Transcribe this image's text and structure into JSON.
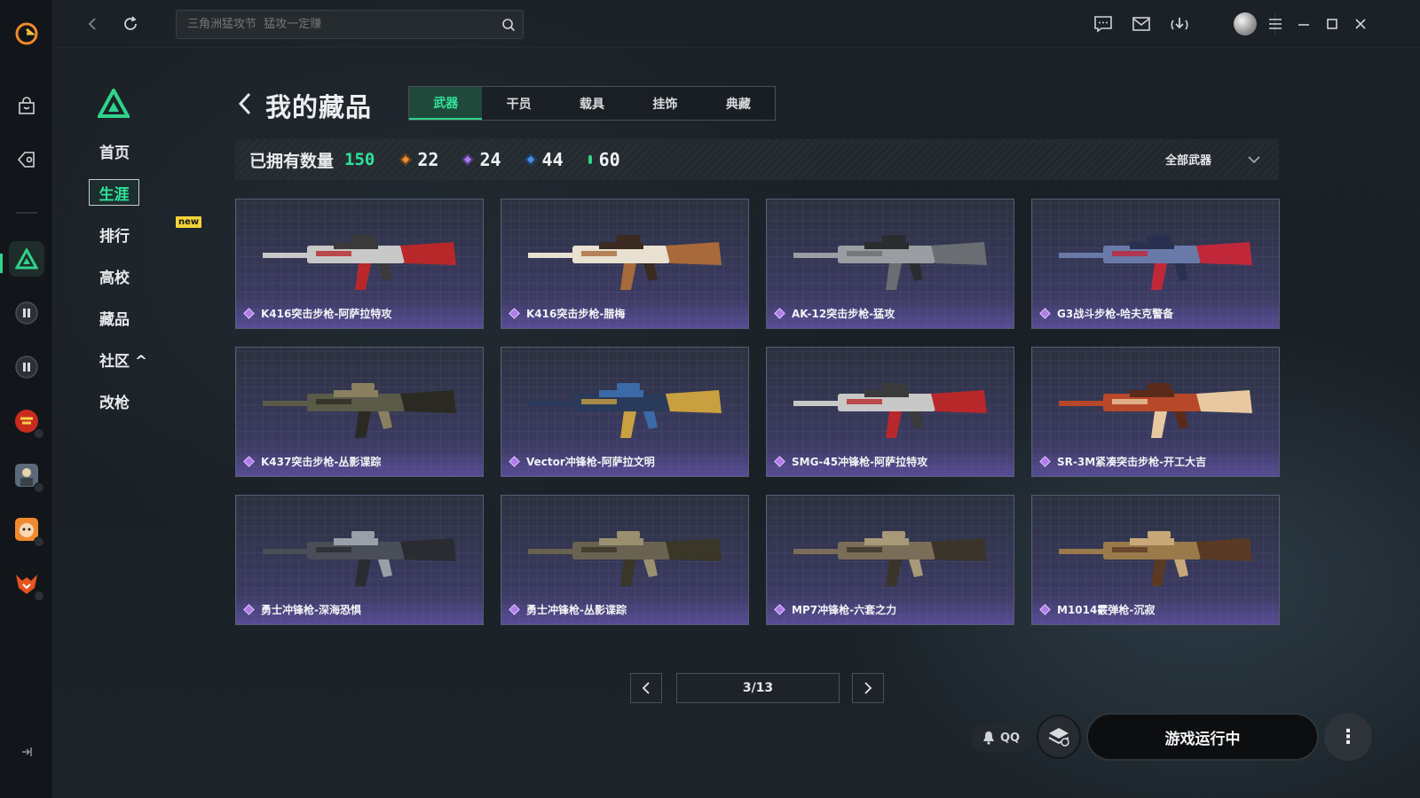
{
  "search": {
    "placeholder": "三角洲猛攻节  猛攻一定赚"
  },
  "sidebar": {
    "items": [
      {
        "label": "首页"
      },
      {
        "label": "生涯"
      },
      {
        "label": "排行"
      },
      {
        "label": "高校"
      },
      {
        "label": "藏品"
      },
      {
        "label": "社区 ^"
      },
      {
        "label": "改枪"
      }
    ],
    "new_tag": "new"
  },
  "header": {
    "title": "我的藏品",
    "tabs": [
      {
        "label": "武器"
      },
      {
        "label": "干员"
      },
      {
        "label": "载具"
      },
      {
        "label": "挂饰"
      },
      {
        "label": "典藏"
      }
    ]
  },
  "stats": {
    "owned_label": "已拥有数量",
    "owned_value": "150",
    "rarities": [
      {
        "color": "#e8903a",
        "value": "22"
      },
      {
        "color": "#a97be6",
        "value": "24"
      },
      {
        "color": "#4b8fe0",
        "value": "44"
      },
      {
        "color": "#2fd38a",
        "value": "60"
      }
    ],
    "filter_label": "全部武器"
  },
  "items": [
    {
      "name": "K416突击步枪-阿萨拉特攻"
    },
    {
      "name": "K416突击步枪-腊梅"
    },
    {
      "name": "AK-12突击步枪-猛攻"
    },
    {
      "name": "G3战斗步枪-哈夫克警备"
    },
    {
      "name": "K437突击步枪-丛影谍踪"
    },
    {
      "name": "Vector冲锋枪-阿萨拉文明"
    },
    {
      "name": "SMG-45冲锋枪-阿萨拉特攻"
    },
    {
      "name": "SR-3M紧凑突击步枪-开工大吉"
    },
    {
      "name": "勇士冲锋枪-深海恐惧"
    },
    {
      "name": "勇士冲锋枪-丛影谍踪"
    },
    {
      "name": "MP7冲锋枪-六套之力"
    },
    {
      "name": "M1014霰弹枪-沉寂"
    }
  ],
  "pagination": {
    "current": "3/13"
  },
  "footer": {
    "qq_label": "QQ",
    "run_label": "游戏运行中"
  },
  "colors": {
    "accent": "#2fd38a"
  }
}
